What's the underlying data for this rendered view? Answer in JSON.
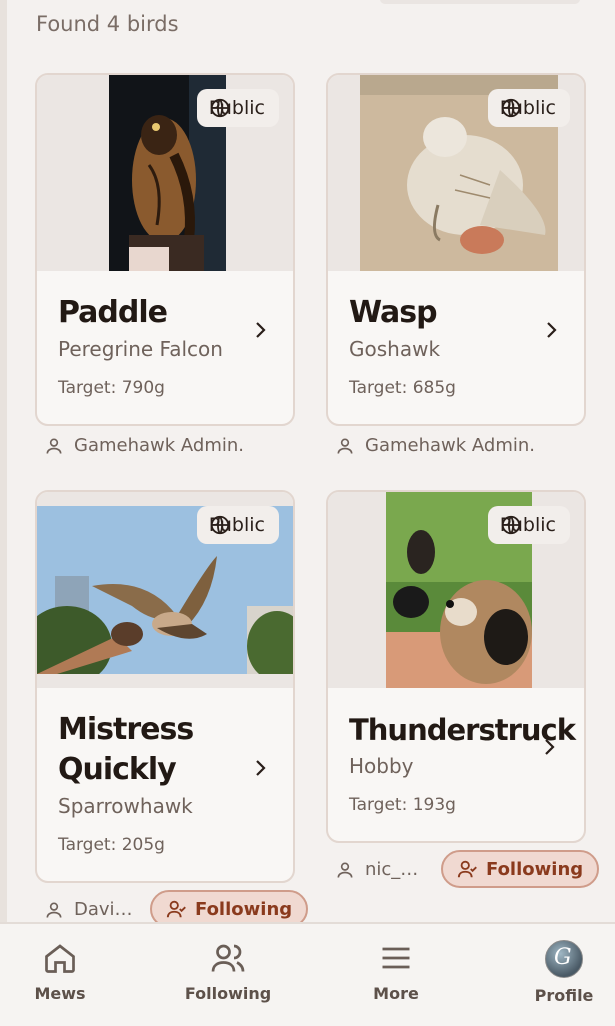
{
  "results_label": "Found 4 birds",
  "birds": [
    {
      "name": "Paddle",
      "species": "Peregrine Falcon",
      "target": "Target: 790g",
      "visibility": "Public",
      "owner": "Gamehawk Admin.",
      "following": ""
    },
    {
      "name": "Wasp",
      "species": "Goshawk",
      "target": "Target: 685g",
      "visibility": "Public",
      "owner": "Gamehawk Admin.",
      "following": ""
    },
    {
      "name_line1": "Mistress",
      "name_line2": "Quickly",
      "species": "Sparrowhawk",
      "target": "Target: 205g",
      "visibility": "Public",
      "owner": "Davi…",
      "following": "Following"
    },
    {
      "name": "Thunderstruck",
      "species": "Hobby",
      "target": "Target: 193g",
      "visibility": "Public",
      "owner": "nic_…",
      "following": "Following"
    }
  ],
  "nav": {
    "items": [
      {
        "label": "Mews",
        "icon": "home-icon"
      },
      {
        "label": "Following",
        "icon": "users-icon"
      },
      {
        "label": "More",
        "icon": "menu-icon"
      },
      {
        "label": "Profile",
        "icon": "avatar"
      }
    ],
    "avatar_letter": "G"
  },
  "colors": {
    "accent": "#8a3a1d",
    "follow_bg": "#f0d9d1",
    "background": "#f4f1ef"
  }
}
